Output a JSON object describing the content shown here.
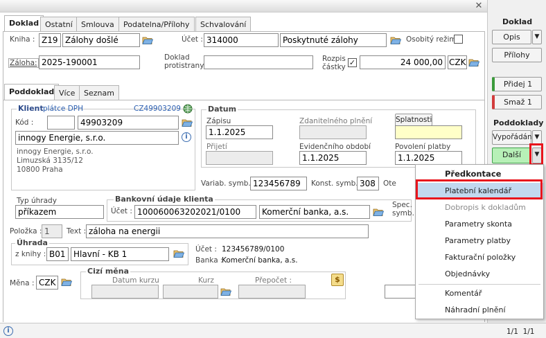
{
  "tabs_main": [
    "Doklad",
    "Ostatní",
    "Smlouva",
    "Podatelna/Přílohy",
    "Schvalování"
  ],
  "header": {
    "kniha_label": "Kniha :",
    "kniha_code": "Z19",
    "kniha_name": "Zálohy došlé",
    "ucet_label": "Účet :",
    "ucet_code": "314000",
    "ucet_name": "Poskytnuté zálohy",
    "osobity_label": "Osobitý režim",
    "zaloha_label": "Záloha:",
    "zaloha_value": "2025-190001",
    "doklad_protistrany_label": "Doklad protistrany",
    "rozpis_label": "Rozpis částky",
    "amount": "24 000,00",
    "currency": "CZK"
  },
  "tabs_sub": [
    "Poddoklad",
    "Více",
    "Seznam"
  ],
  "klient": {
    "title": "Klient",
    "dph": "plátce DPH",
    "dic": "CZ49903209",
    "kod_label": "Kód :",
    "kod_value": "49903209",
    "name": "innogy Energie, s.r.o.",
    "address": [
      "innogy Energie, s.r.o.",
      "Limuzská 3135/12",
      "10800 Praha"
    ]
  },
  "datum": {
    "title": "Datum",
    "zapisu_label": "Zápisu",
    "zapisu": "1.1.2025",
    "zdanitelneho_label": "Zdanitelného plnění",
    "splatnosti_label": "Splatnosti",
    "prijeti_label": "Přijetí",
    "evidencniho_label": "Evidenčního období",
    "evidencniho": "1.1.2025",
    "povoleni_label": "Povolení platby",
    "povoleni": "1.1.2025"
  },
  "symbols": {
    "variab_label": "Variab. symb.",
    "variab": "123456789",
    "konst_label": "Konst. symb.",
    "konst": "308",
    "ote_label": "Ote"
  },
  "typ_uhrady": {
    "label": "Typ úhrady",
    "value": "příkazem"
  },
  "bank": {
    "title": "Bankovní údaje klienta",
    "ucet_label": "Účet :",
    "ucet": "100060063202021/0100",
    "bank_name": "Komerční banka, a.s.",
    "spec_label": "Spec. symb.:"
  },
  "polozka": {
    "label": "Položka :",
    "value": "1",
    "text_label": "Text :",
    "text": "záloha na energii"
  },
  "uhrada": {
    "title": "Úhrada",
    "kniha_label": "z knihy :",
    "kniha_code": "B01",
    "kniha_name": "Hlavní - KB 1",
    "ucet_label": "Účet :",
    "ucet": "123456789/0100",
    "banka_label": "Banka :",
    "banka": "Komerční banka, a.s."
  },
  "mena": {
    "label": "Měna :",
    "value": "CZK"
  },
  "cizi_mena": {
    "title": "Cizí měna",
    "datum_kurzu": "Datum kurzu",
    "kurz": "Kurz",
    "prepocet": "Přepočet :"
  },
  "sidebar": {
    "doklad_title": "Doklad",
    "opis": "Opis",
    "prilohy": "Přílohy",
    "pridej": "Přidej 1",
    "smaz": "Smaž 1",
    "poddoklady_title": "Poddoklady",
    "vyporadani": "Vypořádání",
    "dalsi": "Další",
    "paging": "1/1  1/1"
  },
  "menu": {
    "header": "Předkontace",
    "items": [
      "Platební kalendář",
      "Dobropis k dokladům",
      "Parametry skonta",
      "Parametry platby",
      "Fakturační položky",
      "Objednávky",
      "Komentář",
      "Náhradní plnění"
    ]
  },
  "colors": {
    "highlight": "#c2d9ef",
    "red_box": "#e8141c",
    "green": "#3b9b3b",
    "red": "#d23c3c",
    "dalsi_bg": "#b7f0b7"
  }
}
